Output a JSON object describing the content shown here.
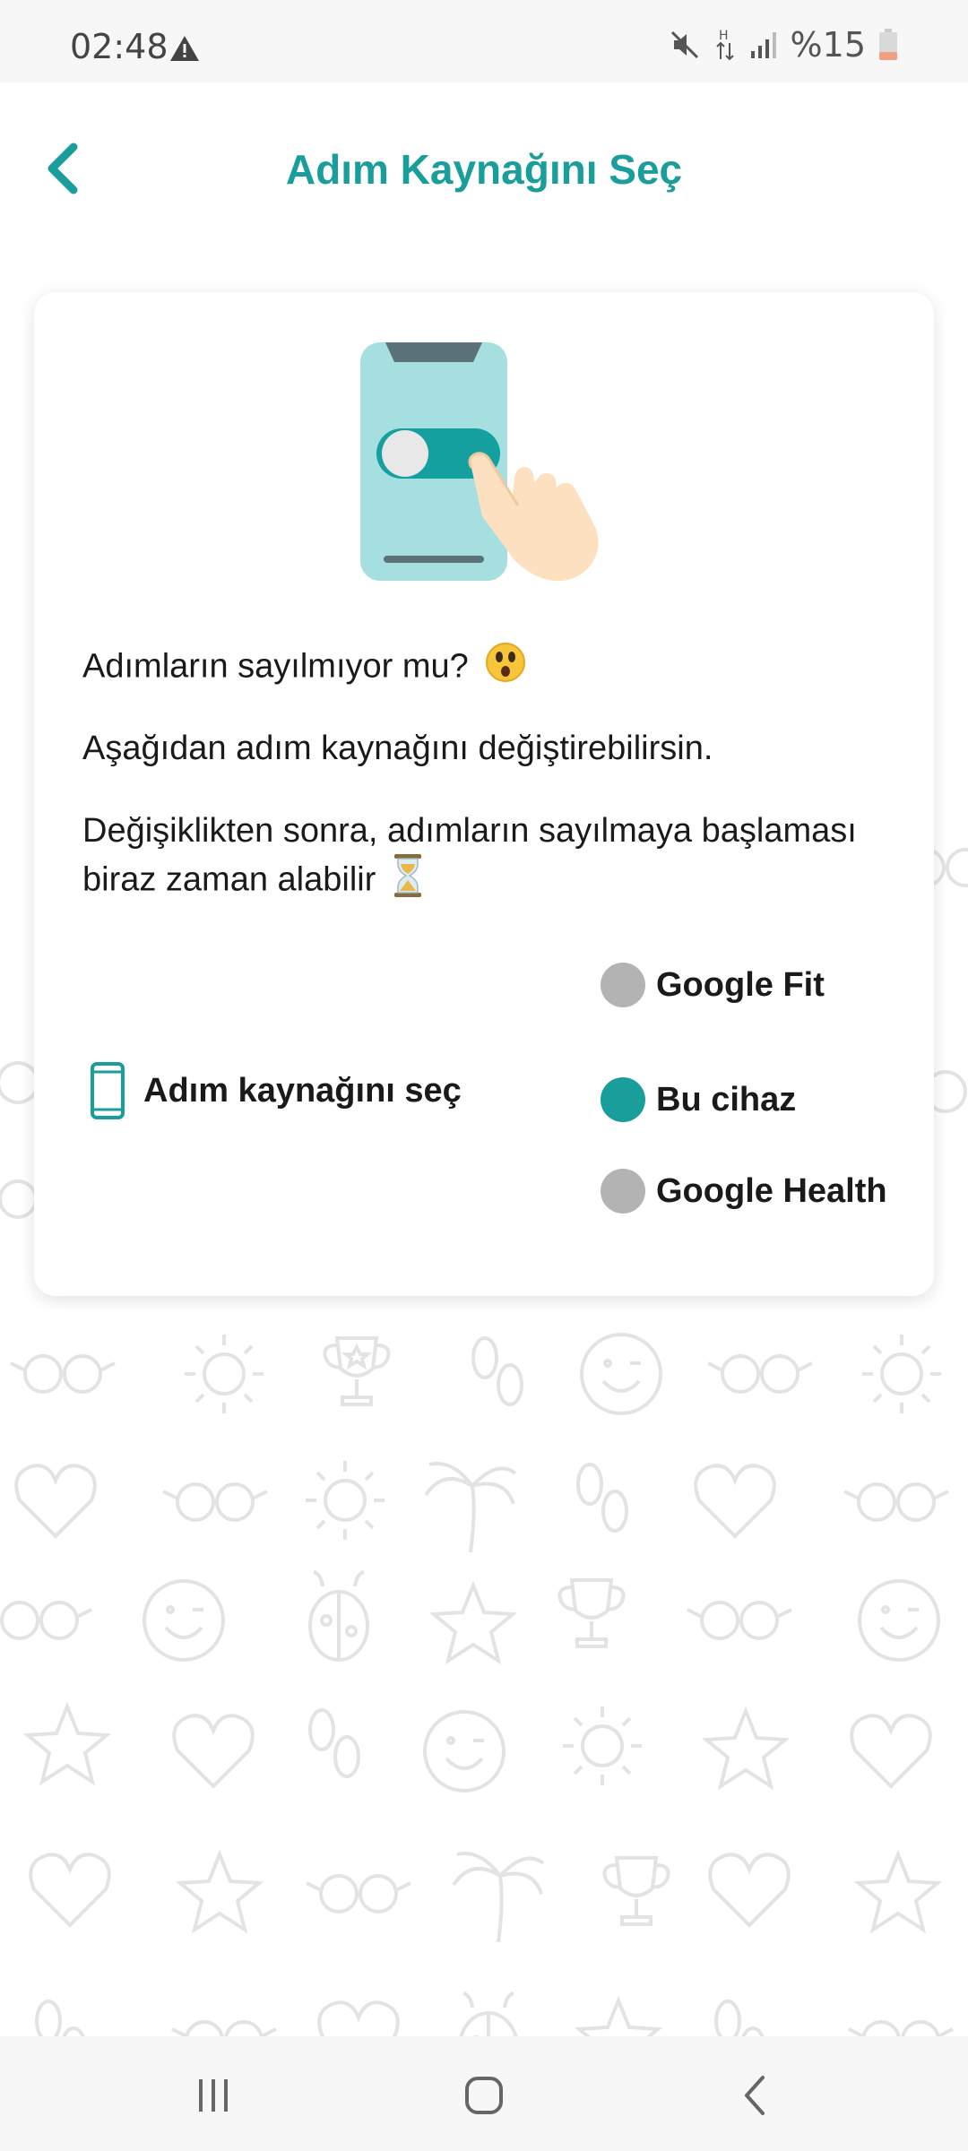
{
  "status_bar": {
    "time": "02:48",
    "battery": "%15",
    "icons": [
      "warning-icon",
      "mute-icon",
      "data-icon",
      "signal-icon",
      "battery-icon"
    ]
  },
  "app_bar": {
    "title": "Adım Kaynağını Seç",
    "back_icon": "chevron-left-icon"
  },
  "card": {
    "question": "Adımların sayılmıyor mu?",
    "question_emoji": "😲",
    "instruction": "Aşağıdan adım kaynağını değiştirebilirsin.",
    "wait_note": "Değişiklikten sonra, adımların sayılmaya başlaması biraz zaman alabilir",
    "wait_emoji": "⏳",
    "source_label": "Adım kaynağını seç",
    "source_icon": "phone-icon",
    "options": [
      {
        "label": "Google Fit",
        "selected": false
      },
      {
        "label": "Bu cihaz",
        "selected": true
      },
      {
        "label": "Google Health",
        "selected": false
      }
    ]
  },
  "colors": {
    "accent": "#1a9e9c",
    "radio_off": "#b3b3b3",
    "pattern": "#e3e3e3"
  },
  "nav_bar": {
    "icons": [
      "recents-icon",
      "home-icon",
      "back-icon"
    ]
  }
}
